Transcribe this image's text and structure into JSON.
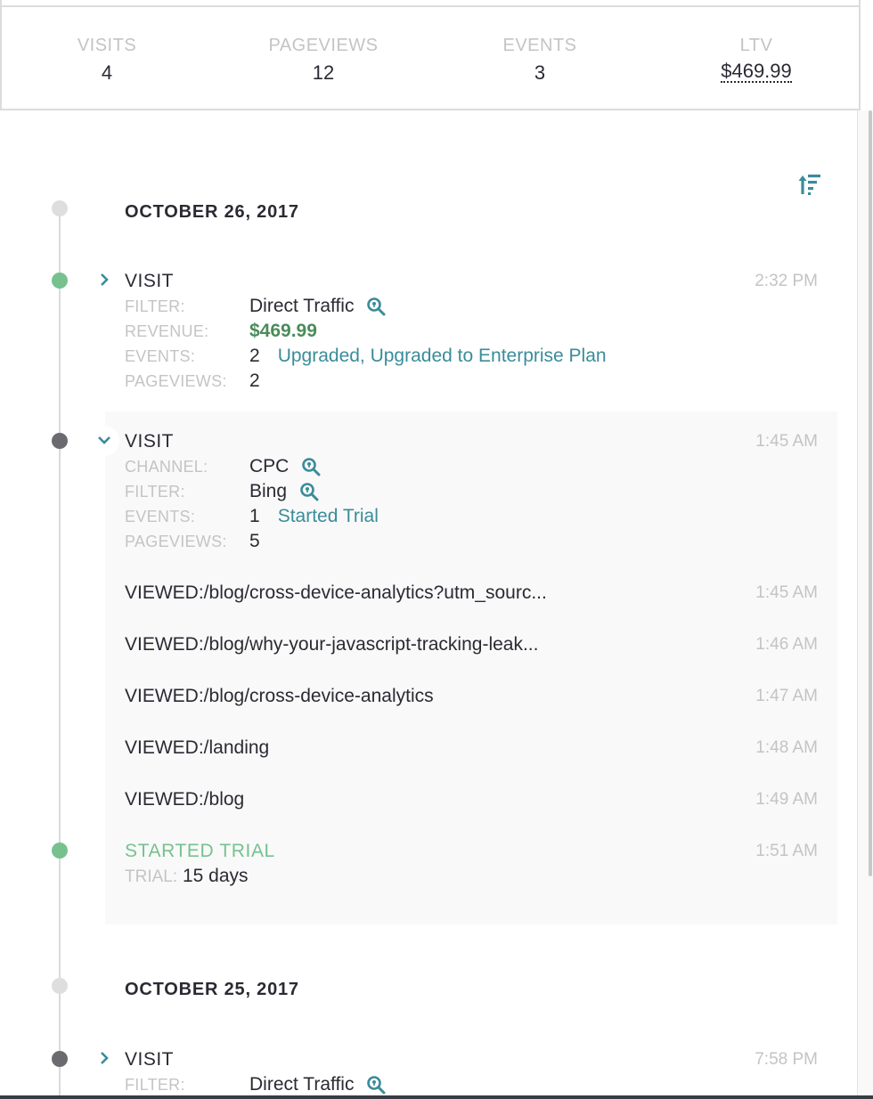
{
  "stats": [
    {
      "label": "VISITS",
      "value": "4"
    },
    {
      "label": "PAGEVIEWS",
      "value": "12"
    },
    {
      "label": "EVENTS",
      "value": "3"
    },
    {
      "label": "LTV",
      "value": "$469.99"
    }
  ],
  "sort_icon": "sort-ascending-icon",
  "colors": {
    "accent": "#3a8c9a",
    "green": "#77c18f",
    "revenue": "#4a8c5a",
    "muted": "#c4c4c4",
    "text": "#2b2a33"
  },
  "days": [
    {
      "date": "OCTOBER 26, 2017",
      "visits": [
        {
          "title": "VISIT",
          "time": "2:32 PM",
          "expanded": false,
          "fields": [
            {
              "key": "FILTER:",
              "value": "Direct Traffic",
              "icon": "search-location-icon"
            },
            {
              "key": "REVENUE:",
              "value": "$469.99"
            },
            {
              "key": "EVENTS:",
              "value": "2",
              "link": "Upgraded, Upgraded to Enterprise Plan"
            },
            {
              "key": "PAGEVIEWS:",
              "value": "2"
            }
          ]
        },
        {
          "title": "VISIT",
          "time": "1:45 AM",
          "expanded": true,
          "fields": [
            {
              "key": "CHANNEL:",
              "value": "CPC",
              "icon": "search-location-icon"
            },
            {
              "key": "FILTER:",
              "value": "Bing",
              "icon": "search-location-icon"
            },
            {
              "key": "EVENTS:",
              "value": "1",
              "link": "Started Trial"
            },
            {
              "key": "PAGEVIEWS:",
              "value": "5"
            }
          ],
          "pageviews": [
            {
              "text": "VIEWED:/blog/cross-device-analytics?utm_sourc...",
              "time": "1:45 AM"
            },
            {
              "text": "VIEWED:/blog/why-your-javascript-tracking-leak...",
              "time": "1:46 AM"
            },
            {
              "text": "VIEWED:/blog/cross-device-analytics",
              "time": "1:47 AM"
            },
            {
              "text": "VIEWED:/landing",
              "time": "1:48 AM"
            },
            {
              "text": "VIEWED:/blog",
              "time": "1:49 AM"
            }
          ],
          "event": {
            "title": "STARTED TRIAL",
            "time": "1:51 AM",
            "key": "TRIAL:",
            "value": "15 days"
          }
        }
      ]
    },
    {
      "date": "OCTOBER 25, 2017",
      "visits": [
        {
          "title": "VISIT",
          "time": "7:58 PM",
          "expanded": false,
          "fields": [
            {
              "key": "FILTER:",
              "value": "Direct Traffic",
              "icon": "search-location-icon"
            }
          ]
        }
      ]
    }
  ]
}
